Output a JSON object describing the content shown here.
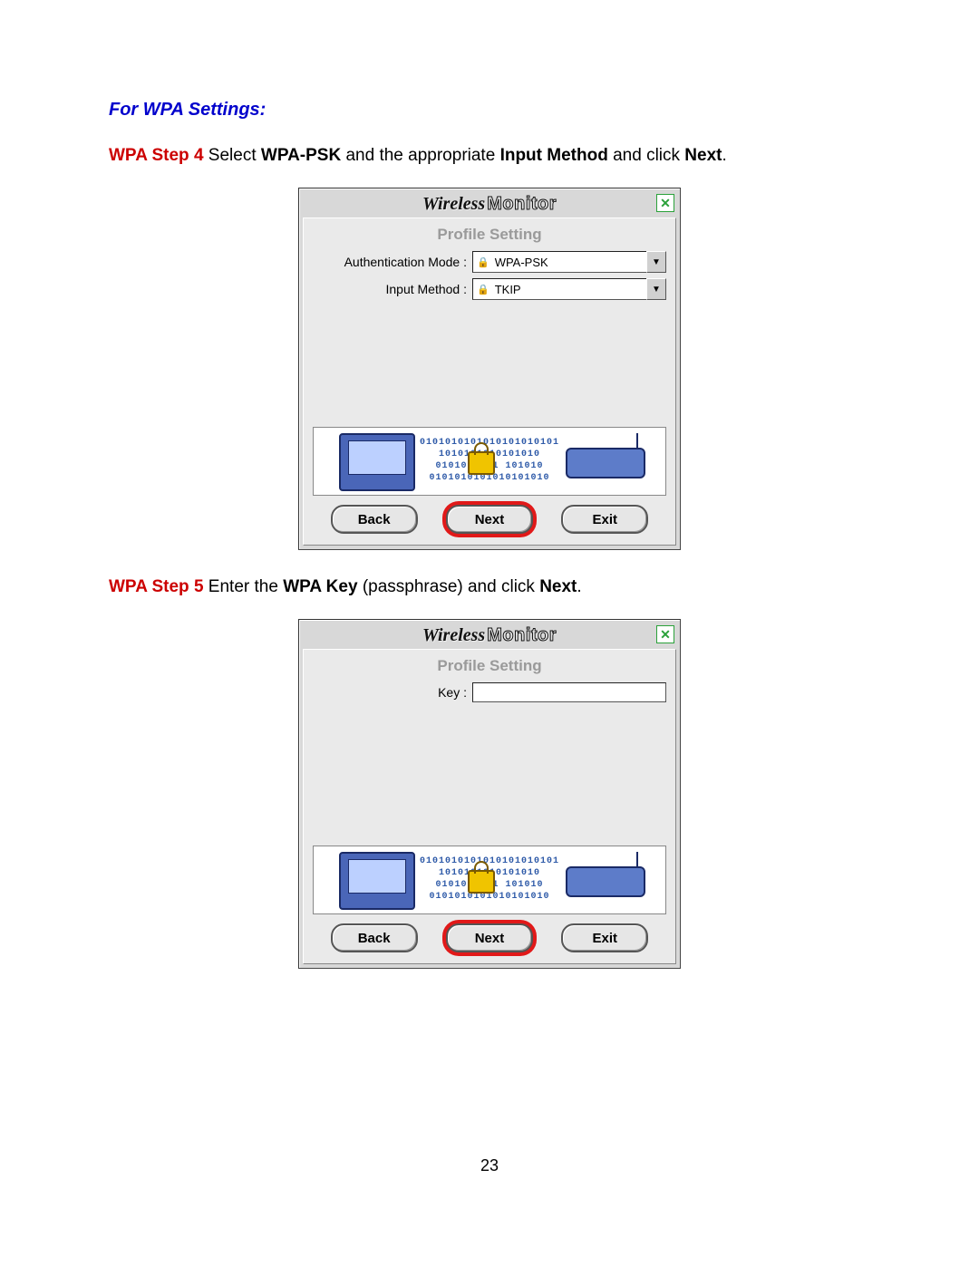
{
  "heading": "For WPA Settings:",
  "step4": {
    "label": "WPA Step 4",
    "text_a": " Select ",
    "b1": "WPA-PSK",
    "text_b": " and the appropriate ",
    "b2": "Input Method",
    "text_c": " and click ",
    "b3": "Next",
    "text_d": "."
  },
  "step5": {
    "label": "WPA Step 5",
    "text_a": " Enter the ",
    "b1": "WPA Key",
    "text_b": " (passphrase) and click ",
    "b2": "Next",
    "text_c": "."
  },
  "dialog": {
    "title_wireless": "Wireless",
    "title_monitor": "Monitor",
    "panel_title": "Profile Setting",
    "bits": "0101010101010101010101\n1010101010101010\n0101010101 101010\n0101010101010101010"
  },
  "dlg1": {
    "auth_label": "Authentication Mode :",
    "auth_value": "WPA-PSK",
    "input_label": "Input Method :",
    "input_value": "TKIP"
  },
  "dlg2": {
    "key_label": "Key :",
    "key_value": ""
  },
  "buttons": {
    "back": "Back",
    "next": "Next",
    "exit": "Exit"
  },
  "page_number": "23"
}
